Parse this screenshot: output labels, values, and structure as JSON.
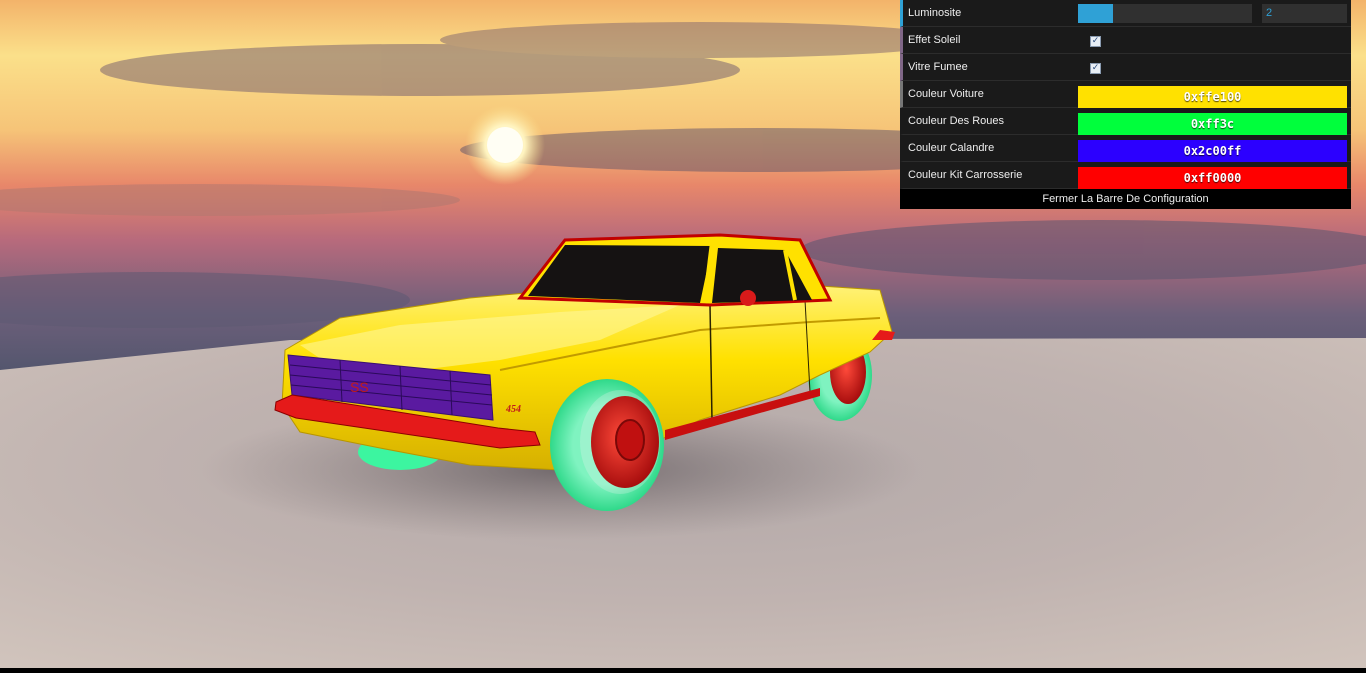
{
  "gui": {
    "luminosite": {
      "label": "Luminosite",
      "value": "2",
      "fraction": 0.2
    },
    "effet_soleil": {
      "label": "Effet Soleil",
      "checked": true
    },
    "vitre_fumee": {
      "label": "Vitre Fumee",
      "checked": true
    },
    "colors": [
      {
        "label": "Couleur Voiture",
        "value": "0xffe100",
        "color": "#ffe100"
      },
      {
        "label": "Couleur Des Roues",
        "value": "0xff3c",
        "color": "#00ff3c"
      },
      {
        "label": "Couleur Calandre",
        "value": "0x2c00ff",
        "color": "#2c00ff"
      },
      {
        "label": "Couleur Kit Carrosserie",
        "value": "0xff0000",
        "color": "#ff0000"
      }
    ],
    "close_label": "Fermer La Barre De Configuration"
  },
  "car": {
    "badge": "454",
    "body_color": "#ffe100",
    "wheel_color": "#3cf5a0",
    "rim_color": "#e01818",
    "grille_color": "#5a1aa0"
  }
}
